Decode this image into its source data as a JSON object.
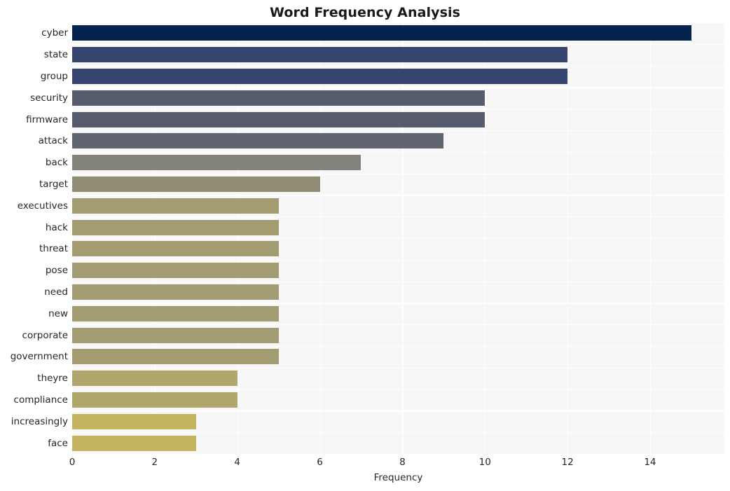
{
  "chart_data": {
    "type": "bar",
    "orientation": "horizontal",
    "title": "Word Frequency Analysis",
    "xlabel": "Frequency",
    "ylabel": "",
    "categories": [
      "cyber",
      "state",
      "group",
      "security",
      "firmware",
      "attack",
      "back",
      "target",
      "executives",
      "hack",
      "threat",
      "pose",
      "need",
      "new",
      "corporate",
      "government",
      "theyre",
      "compliance",
      "increasingly",
      "face"
    ],
    "values": [
      15,
      12,
      12,
      10,
      10,
      9,
      7,
      6,
      5,
      5,
      5,
      5,
      5,
      5,
      5,
      5,
      4,
      4,
      3,
      3
    ],
    "bar_colors": [
      "#04234d",
      "#364570",
      "#364570",
      "#565c6e",
      "#565c6e",
      "#616570",
      "#83827b",
      "#918d75",
      "#a39c73",
      "#a39c73",
      "#a39c73",
      "#a39c73",
      "#a39c73",
      "#a39c73",
      "#a39c73",
      "#a39c73",
      "#b0a76c",
      "#b0a76c",
      "#c3b55f",
      "#c3b55f"
    ],
    "xlim": [
      0,
      15.8
    ],
    "xticks": [
      0,
      2,
      4,
      6,
      8,
      10,
      12,
      14
    ],
    "xtick_labels": [
      "0",
      "2",
      "4",
      "6",
      "8",
      "10",
      "12",
      "14"
    ],
    "grid": "white gridlines on light gray plot background",
    "legend": "none",
    "plot_background": "#f7f7f7",
    "figure_background": "#ffffff"
  }
}
